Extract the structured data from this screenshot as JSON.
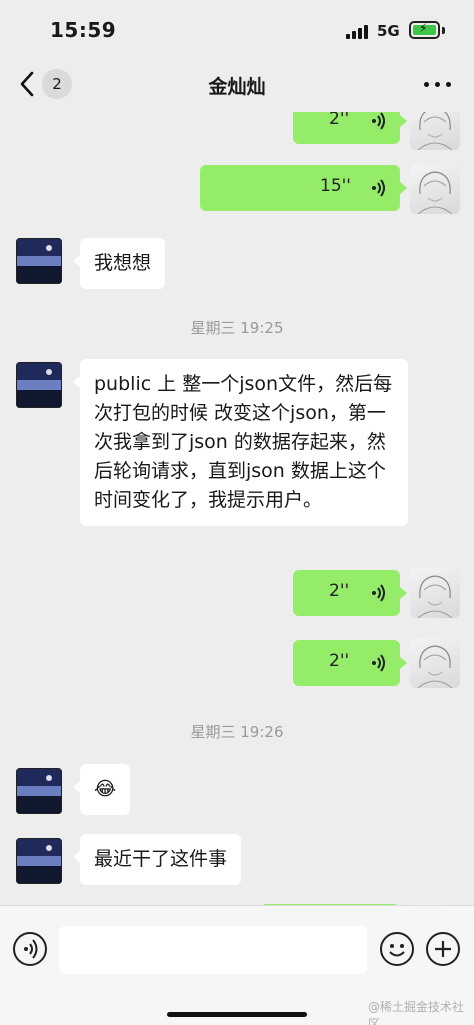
{
  "status_bar": {
    "time": "15:59",
    "network": "5G",
    "battery_color": "#3fc44a"
  },
  "nav": {
    "unread_count": "2",
    "title": "金灿灿"
  },
  "messages": [
    {
      "type": "voice",
      "from": "me",
      "duration": "2''"
    },
    {
      "type": "voice",
      "from": "me",
      "duration": "15''"
    },
    {
      "type": "text",
      "from": "other",
      "text": "我想想"
    },
    {
      "type": "time",
      "text": "星期三 19:25"
    },
    {
      "type": "text",
      "from": "other",
      "text": "public 上 整一个json文件，然后每次打包的时候 改变这个json，第一次我拿到了json 的数据存起来，然后轮询请求，直到json 数据上这个时间变化了，我提示用户。"
    },
    {
      "type": "voice",
      "from": "me",
      "duration": "2''"
    },
    {
      "type": "voice",
      "from": "me",
      "duration": "2''"
    },
    {
      "type": "time",
      "text": "星期三 19:26"
    },
    {
      "type": "text",
      "from": "other",
      "text": "😂"
    },
    {
      "type": "text",
      "from": "other",
      "text": "最近干了这件事"
    }
  ],
  "input_bar": {
    "icons": [
      "voice-mode-icon",
      "emoji-icon",
      "plus-icon"
    ],
    "watermark": "@稀土掘金技术社区"
  },
  "colors": {
    "my_bubble": "#95ec69",
    "other_bubble": "#ffffff",
    "background": "#ededed"
  }
}
